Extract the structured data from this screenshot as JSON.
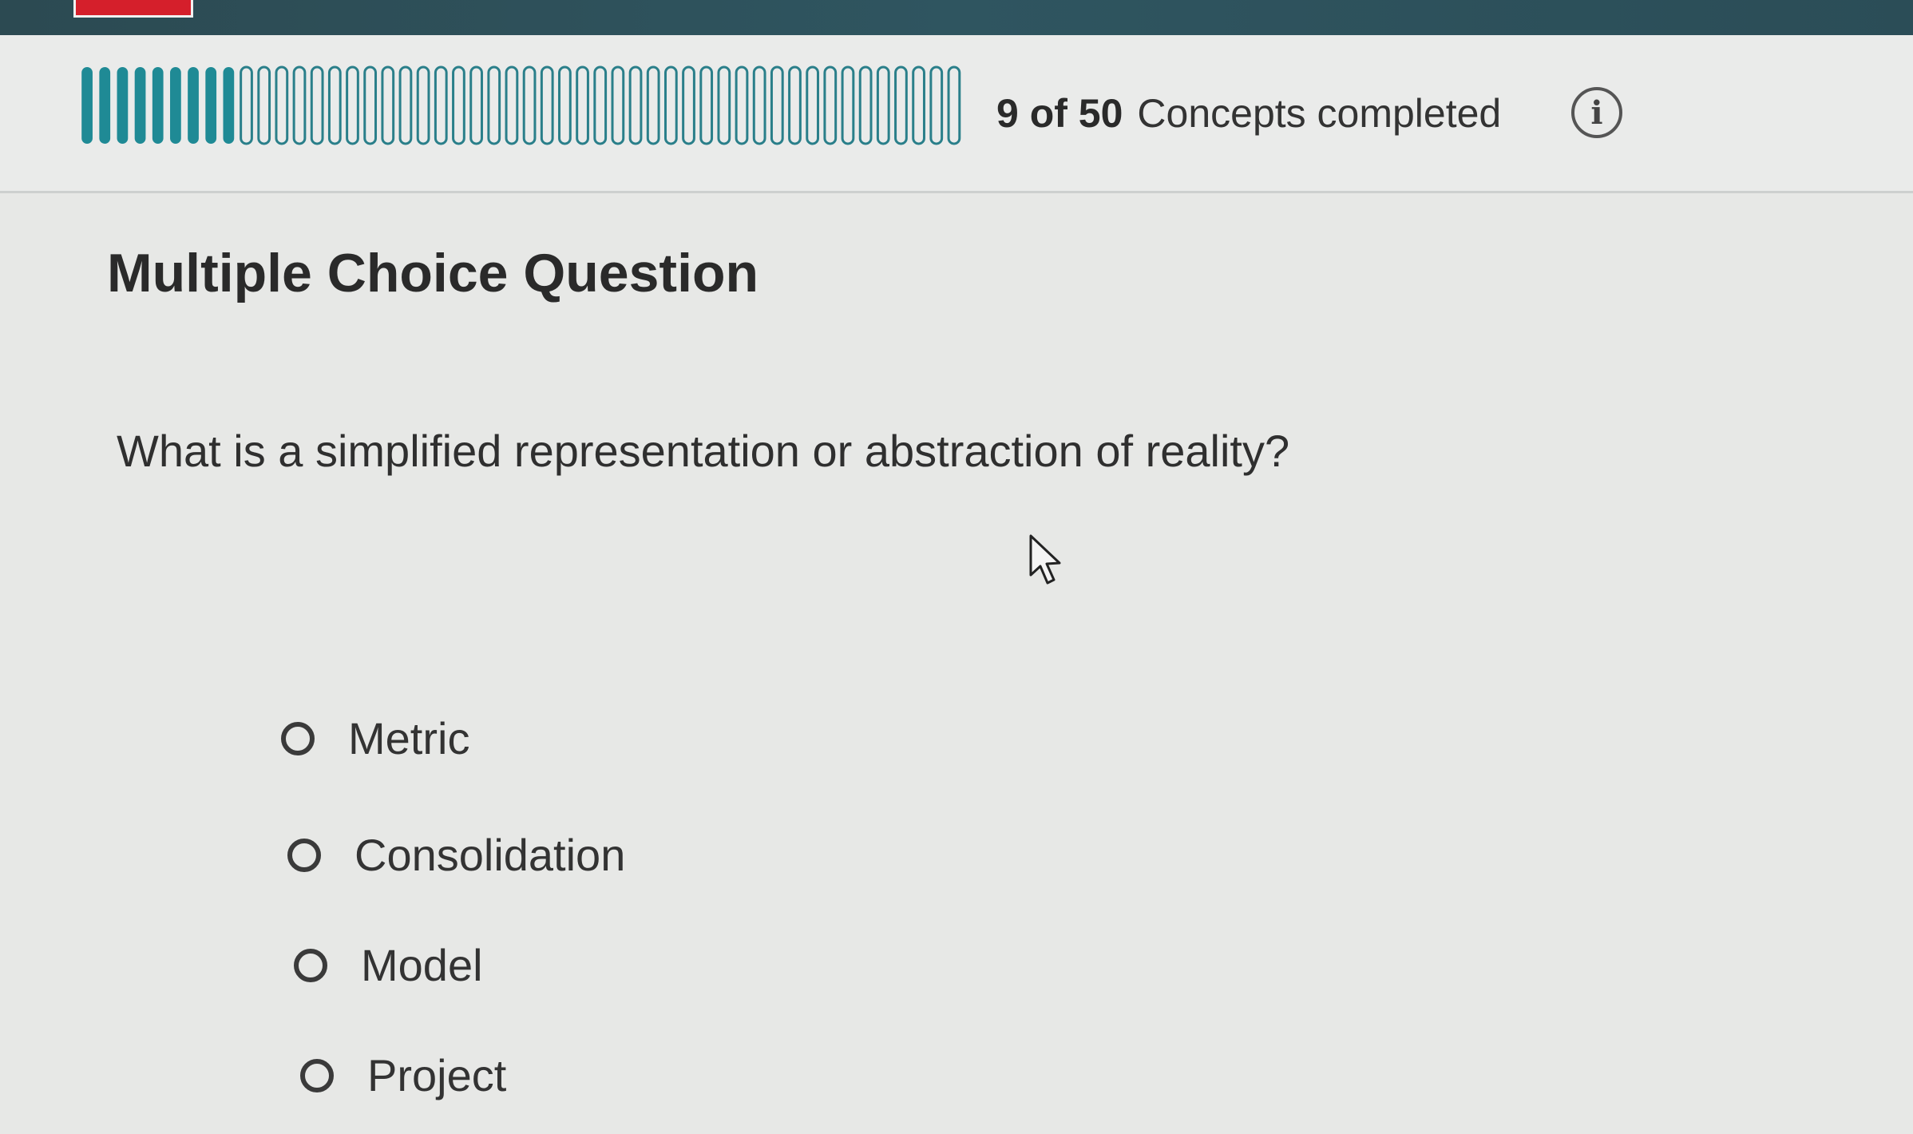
{
  "progress": {
    "completed": 9,
    "total": 50,
    "count_text": "9 of 50",
    "suffix_text": "Concepts completed",
    "info_icon": "info-circle-icon",
    "info_glyph": "i"
  },
  "question": {
    "type_heading": "Multiple Choice Question",
    "prompt": "What is a simplified representation or abstraction of reality?",
    "options": [
      {
        "label": "Metric"
      },
      {
        "label": "Consolidation"
      },
      {
        "label": "Model"
      },
      {
        "label": "Project"
      }
    ]
  },
  "colors": {
    "topbar": "#2c4a52",
    "progress_complete": "#1f8a95",
    "progress_incomplete": "#2a7f8a",
    "logo_accent": "#d51f2b"
  },
  "icons": {
    "cursor": "mouse-pointer-icon",
    "radio": "radio-unselected-icon"
  }
}
